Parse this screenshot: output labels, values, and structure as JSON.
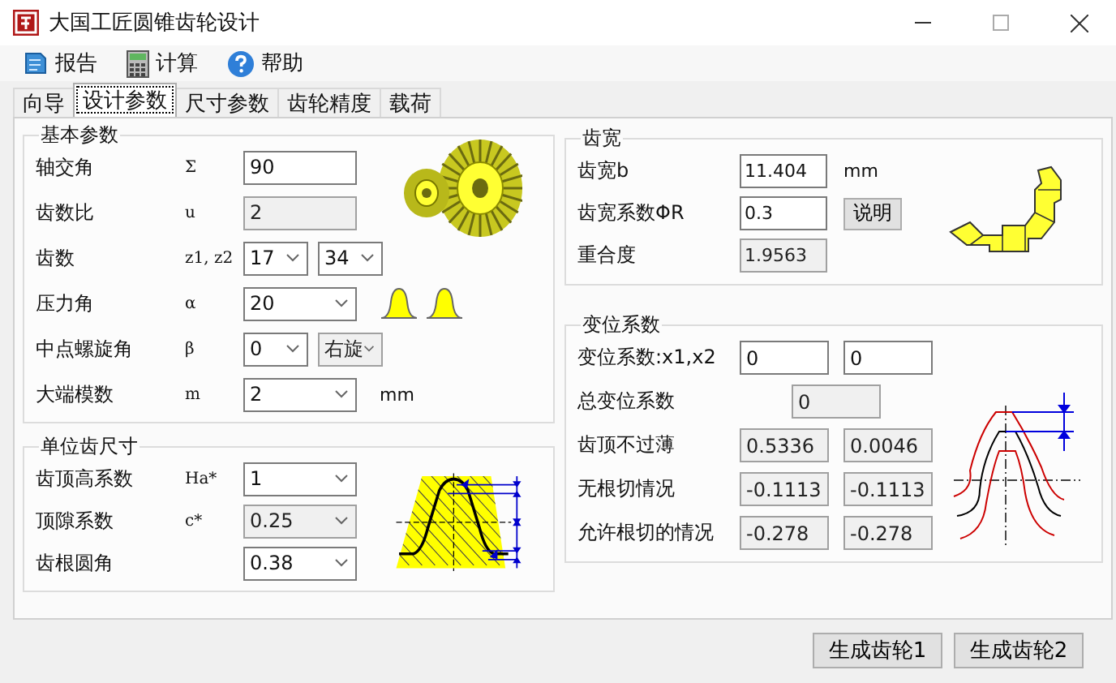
{
  "window": {
    "title": "大国工匠圆锥齿轮设计"
  },
  "menu": [
    {
      "label": "报告",
      "kind": "report"
    },
    {
      "label": "计算",
      "kind": "calc"
    },
    {
      "label": "帮助",
      "kind": "help"
    }
  ],
  "tabs": [
    {
      "label": "向导",
      "selected": false
    },
    {
      "label": "设计参数",
      "selected": true
    },
    {
      "label": "尺寸参数",
      "selected": false
    },
    {
      "label": "齿轮精度",
      "selected": false
    },
    {
      "label": "载荷",
      "selected": false
    }
  ],
  "groups": [
    {
      "title": "基本参数",
      "kind": "basic",
      "rows": [
        {
          "label": "轴交角",
          "symbol": "Σ",
          "controls": [
            {
              "kind": "input",
              "value": "90",
              "disabled": false
            }
          ]
        },
        {
          "label": "齿数比",
          "symbol": "u",
          "controls": [
            {
              "kind": "input",
              "value": "2",
              "disabled": true
            }
          ]
        },
        {
          "label": "齿数",
          "symbol": "z1, z2",
          "controls": [
            {
              "kind": "select",
              "value": "17",
              "disabled": false
            },
            {
              "kind": "select",
              "value": "34",
              "disabled": false
            }
          ]
        },
        {
          "label": "压力角",
          "symbol": "α",
          "controls": [
            {
              "kind": "select",
              "value": "20",
              "disabled": false
            },
            {
              "kind": "profiles"
            }
          ]
        },
        {
          "label": "中点螺旋角",
          "symbol": "β",
          "controls": [
            {
              "kind": "select",
              "value": "0",
              "disabled": false
            },
            {
              "kind": "select",
              "value": "右旋",
              "disabled": true
            }
          ]
        },
        {
          "label": "大端模数",
          "symbol": "m",
          "controls": [
            {
              "kind": "select",
              "value": "2",
              "disabled": false
            },
            {
              "kind": "unit",
              "value": "mm"
            }
          ]
        }
      ]
    },
    {
      "title": "单位齿尺寸",
      "kind": "unit",
      "rows": [
        {
          "label": "齿顶高系数",
          "symbol": "Ha*",
          "controls": [
            {
              "kind": "select",
              "value": "1",
              "disabled": false
            }
          ]
        },
        {
          "label": "顶隙系数",
          "symbol": "c*",
          "controls": [
            {
              "kind": "select",
              "value": "0.25",
              "disabled": true
            }
          ]
        },
        {
          "label": "齿根圆角",
          "controls": [
            {
              "kind": "select",
              "value": "0.38",
              "disabled": false
            }
          ]
        }
      ]
    },
    {
      "title": "齿宽",
      "kind": "width",
      "rows": [
        {
          "label": "齿宽b",
          "controls": [
            {
              "kind": "input",
              "value": "11.404",
              "disabled": false
            },
            {
              "kind": "unit",
              "value": "mm"
            }
          ]
        },
        {
          "label": "齿宽系数ΦR",
          "controls": [
            {
              "kind": "input",
              "value": "0.3",
              "disabled": false
            },
            {
              "kind": "button",
              "value": "说明"
            }
          ]
        },
        {
          "label": "重合度",
          "controls": [
            {
              "kind": "input",
              "value": "1.9563",
              "disabled": true
            }
          ]
        }
      ]
    },
    {
      "title": "变位系数",
      "kind": "shift",
      "rows": [
        {
          "label": "变位系数:x1,x2",
          "controls": [
            {
              "kind": "input",
              "value": "0",
              "disabled": false
            },
            {
              "kind": "input",
              "value": "0",
              "disabled": false
            }
          ]
        },
        {
          "label": "总变位系数",
          "controls": [
            {
              "kind": "input",
              "value": "0",
              "disabled": true
            }
          ]
        },
        {
          "label": "齿顶不过薄",
          "controls": [
            {
              "kind": "input",
              "value": "0.5336",
              "disabled": true
            },
            {
              "kind": "input",
              "value": "0.0046",
              "disabled": true
            }
          ]
        },
        {
          "label": "无根切情况",
          "controls": [
            {
              "kind": "input",
              "value": "-0.1113",
              "disabled": true
            },
            {
              "kind": "input",
              "value": "-0.1113",
              "disabled": true
            }
          ]
        },
        {
          "label": "允许根切的情况",
          "controls": [
            {
              "kind": "input",
              "value": "-0.278",
              "disabled": true
            },
            {
              "kind": "input",
              "value": "-0.278",
              "disabled": true
            }
          ]
        }
      ]
    }
  ],
  "buttons": [
    {
      "label": "生成齿轮1"
    },
    {
      "label": "生成齿轮2"
    }
  ]
}
